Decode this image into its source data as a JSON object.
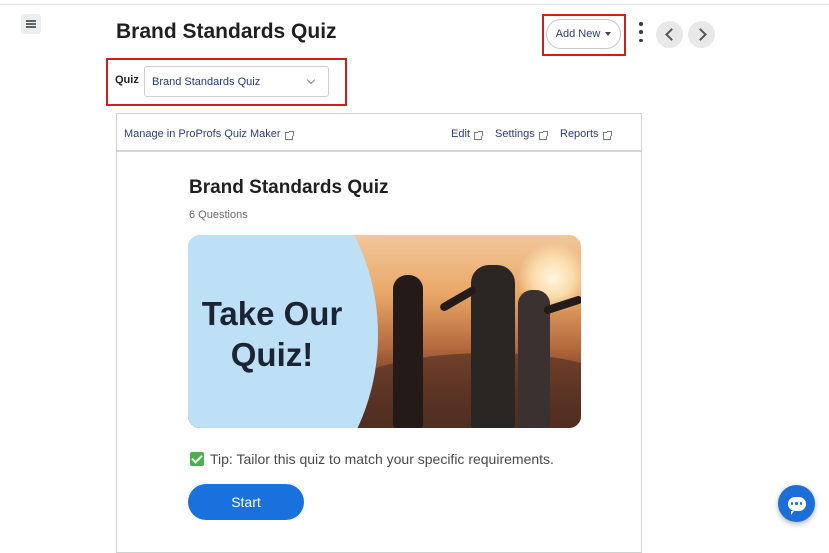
{
  "header": {
    "title": "Brand Standards Quiz",
    "add_new_label": "Add New",
    "icons": {
      "menu": "hamburger-menu-icon",
      "more": "more-vertical-icon",
      "prev": "chevron-left-icon",
      "next": "chevron-right-icon",
      "dropdown": "caret-down-icon"
    }
  },
  "quiz_selector": {
    "label": "Quiz",
    "selected": "Brand Standards Quiz"
  },
  "panel": {
    "manage_link": "Manage in ProProfs Quiz Maker",
    "edit_link": "Edit",
    "settings_link": "Settings",
    "reports_link": "Reports"
  },
  "quiz": {
    "title": "Brand Standards Quiz",
    "question_count": "6 Questions",
    "banner_line1": "Take Our",
    "banner_line2": "Quiz!",
    "tip": "Tip: Tailor this quiz to match your specific requirements.",
    "start_label": "Start"
  },
  "colors": {
    "accent": "#1971dd",
    "highlight_border": "#d11f1f",
    "link": "#2c3f79",
    "banner_circle": "#bee0f7"
  }
}
